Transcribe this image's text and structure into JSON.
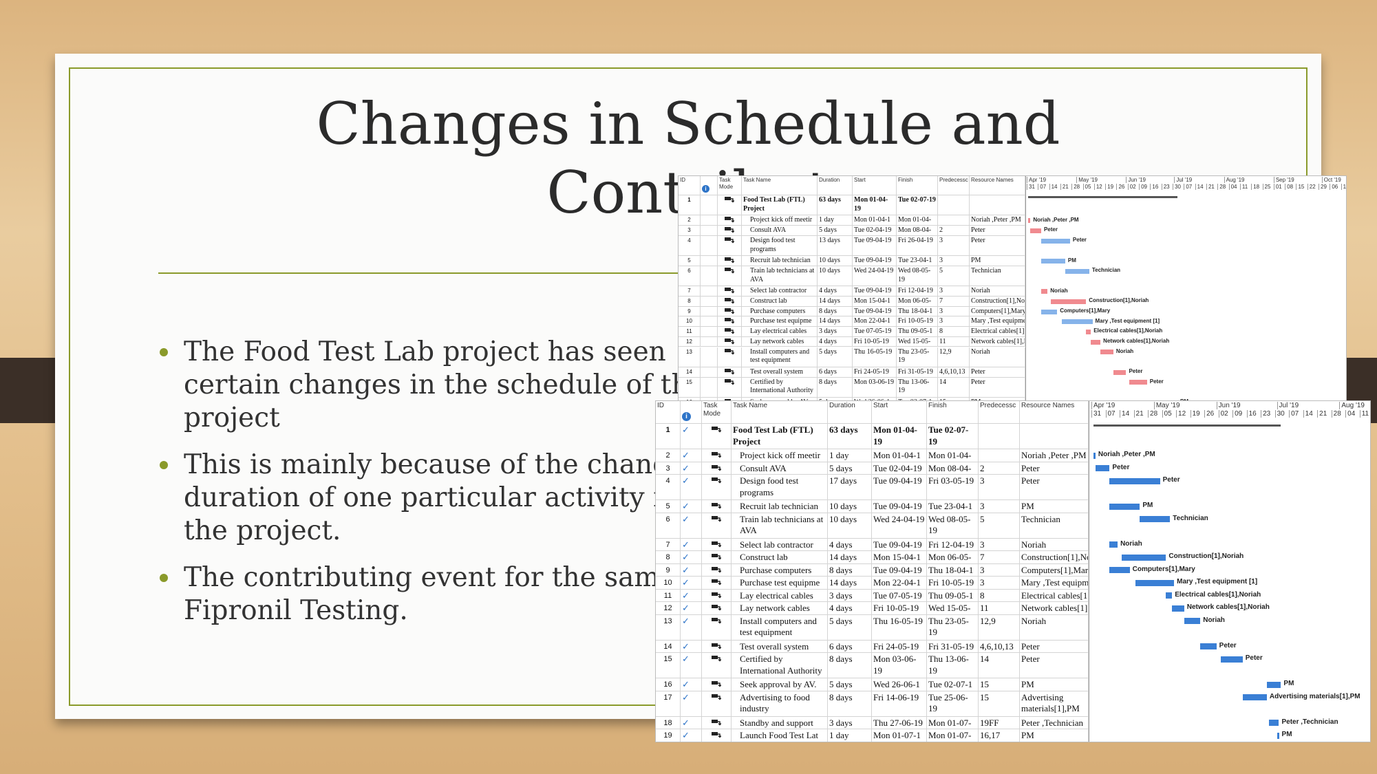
{
  "slide": {
    "title_lines": [
      "Changes in Schedule and",
      "Contribut"
    ],
    "bullets": [
      "The Food Test Lab project has seen certain changes in the schedule of the project",
      "This is mainly because of the change in duration of one particular activity in the project.",
      "The contributing event for the same is Fipronil Testing."
    ]
  },
  "colors": {
    "accent": "#8a9a2a",
    "critical_bar": "#f08a8f",
    "task_bar_top": "#86b3ea",
    "task_bar_bottom": "#3a7fd5",
    "frame_dark": "#3b2f27"
  },
  "columns": {
    "id": "ID",
    "indicator_icon": "info-icon",
    "mode": "Task Mode",
    "name": "Task Name",
    "duration": "Duration",
    "start": "Start",
    "finish": "Finish",
    "pred": "Predecessc",
    "res": "Resource Names"
  },
  "top_gantt": {
    "months": [
      [
        "Apr '19",
        "2019-03-31"
      ],
      [
        "May '19",
        "2019-05-01"
      ],
      [
        "Jun '19",
        "2019-06-01"
      ],
      [
        "Jul '19",
        "2019-07-01"
      ],
      [
        "Aug '19",
        "2019-08-01"
      ],
      [
        "Sep '19",
        "2019-09-01"
      ],
      [
        "Oct '19",
        "2019-10-01"
      ]
    ],
    "weeks": [
      "31",
      "07",
      "14",
      "21",
      "28",
      "05",
      "12",
      "19",
      "26",
      "02",
      "09",
      "16",
      "23",
      "30",
      "07",
      "14",
      "21",
      "28",
      "04",
      "11",
      "18",
      "25",
      "01",
      "08",
      "15",
      "22",
      "29",
      "06",
      "13"
    ],
    "tasks": [
      {
        "id": "1",
        "name": "Food Test Lab (FTL) Project",
        "duration": "63 days",
        "start": "Mon 01-04-19",
        "finish": "Tue 02-07-19",
        "pred": "",
        "res": "",
        "bar": [
          "2019-04-01",
          "2019-07-02"
        ],
        "summary": true
      },
      {
        "id": "2",
        "name": "Project kick off meetir",
        "duration": "1 day",
        "start": "Mon 01-04-1",
        "finish": "Mon 01-04-",
        "pred": "",
        "res": "Noriah ,Peter ,PM",
        "bar": [
          "2019-04-01",
          "2019-04-01"
        ],
        "critical": true
      },
      {
        "id": "3",
        "name": "Consult AVA",
        "duration": "5 days",
        "start": "Tue 02-04-19",
        "finish": "Mon 08-04-",
        "pred": "2",
        "res": "Peter",
        "bar": [
          "2019-04-02",
          "2019-04-08"
        ],
        "critical": true
      },
      {
        "id": "4",
        "name": "Design food test programs",
        "duration": "13 days",
        "start": "Tue 09-04-19",
        "finish": "Fri 26-04-19",
        "pred": "3",
        "res": "Peter",
        "bar": [
          "2019-04-09",
          "2019-04-26"
        ],
        "critical": false
      },
      {
        "id": "5",
        "name": "Recruit lab technician",
        "duration": "10 days",
        "start": "Tue 09-04-19",
        "finish": "Tue 23-04-1",
        "pred": "3",
        "res": "PM",
        "bar": [
          "2019-04-09",
          "2019-04-23"
        ],
        "critical": false
      },
      {
        "id": "6",
        "name": "Train lab technicians at AVA",
        "duration": "10 days",
        "start": "Wed 24-04-19",
        "finish": "Wed 08-05-19",
        "pred": "5",
        "res": "Technician",
        "bar": [
          "2019-04-24",
          "2019-05-08"
        ],
        "critical": false
      },
      {
        "id": "7",
        "name": "Select lab contractor",
        "duration": "4 days",
        "start": "Tue 09-04-19",
        "finish": "Fri 12-04-19",
        "pred": "3",
        "res": "Noriah",
        "bar": [
          "2019-04-09",
          "2019-04-12"
        ],
        "critical": true
      },
      {
        "id": "8",
        "name": "Construct lab",
        "duration": "14 days",
        "start": "Mon 15-04-1",
        "finish": "Mon 06-05-",
        "pred": "7",
        "res": "Construction[1],Noriah",
        "bar": [
          "2019-04-15",
          "2019-05-06"
        ],
        "critical": true
      },
      {
        "id": "9",
        "name": "Purchase computers",
        "duration": "8 days",
        "start": "Tue 09-04-19",
        "finish": "Thu 18-04-1",
        "pred": "3",
        "res": "Computers[1],Mary",
        "bar": [
          "2019-04-09",
          "2019-04-18"
        ],
        "critical": false
      },
      {
        "id": "10",
        "name": "Purchase test equipme",
        "duration": "14 days",
        "start": "Mon 22-04-1",
        "finish": "Fri 10-05-19",
        "pred": "3",
        "res": "Mary ,Test equipment [1]",
        "bar": [
          "2019-04-22",
          "2019-05-10"
        ],
        "critical": false
      },
      {
        "id": "11",
        "name": "Lay electrical cables",
        "duration": "3 days",
        "start": "Tue 07-05-19",
        "finish": "Thu 09-05-1",
        "pred": "8",
        "res": "Electrical cables[1],Noriah",
        "bar": [
          "2019-05-07",
          "2019-05-09"
        ],
        "critical": true
      },
      {
        "id": "12",
        "name": "Lay network cables",
        "duration": "4 days",
        "start": "Fri 10-05-19",
        "finish": "Wed 15-05-",
        "pred": "11",
        "res": "Network cables[1],Noriah",
        "bar": [
          "2019-05-10",
          "2019-05-15"
        ],
        "critical": true
      },
      {
        "id": "13",
        "name": "Install computers and test equipment",
        "duration": "5 days",
        "start": "Thu 16-05-19",
        "finish": "Thu 23-05-19",
        "pred": "12,9",
        "res": "Noriah",
        "bar": [
          "2019-05-16",
          "2019-05-23"
        ],
        "critical": true
      },
      {
        "id": "14",
        "name": "Test overall system",
        "duration": "6 days",
        "start": "Fri 24-05-19",
        "finish": "Fri 31-05-19",
        "pred": "4,6,10,13",
        "res": "Peter",
        "bar": [
          "2019-05-24",
          "2019-05-31"
        ],
        "critical": true
      },
      {
        "id": "15",
        "name": "Certified by International Authority",
        "duration": "8 days",
        "start": "Mon 03-06-19",
        "finish": "Thu 13-06-19",
        "pred": "14",
        "res": "Peter",
        "bar": [
          "2019-06-03",
          "2019-06-13"
        ],
        "critical": true
      },
      {
        "id": "16",
        "name": "Seek approval by AV.",
        "duration": "5 days",
        "start": "Wed 26-06-1",
        "finish": "Tue 02-07-1",
        "pred": "15",
        "res": "PM",
        "bar": [
          "2019-06-26",
          "2019-07-02"
        ],
        "critical": true
      }
    ]
  },
  "bottom_gantt": {
    "months": [
      [
        "Apr '19",
        "2019-03-31"
      ],
      [
        "May '19",
        "2019-05-01"
      ],
      [
        "Jun '19",
        "2019-06-01"
      ],
      [
        "Jul '19",
        "2019-07-01"
      ],
      [
        "Aug '19",
        "2019-08-01"
      ]
    ],
    "weeks": [
      "31",
      "07",
      "14",
      "21",
      "28",
      "05",
      "12",
      "19",
      "26",
      "02",
      "09",
      "16",
      "23",
      "30",
      "07",
      "14",
      "21",
      "28",
      "04",
      "11"
    ],
    "tasks": [
      {
        "id": "1",
        "name": "Food Test Lab (FTL) Project",
        "duration": "63 days",
        "start": "Mon 01-04-19",
        "finish": "Tue 02-07-19",
        "pred": "",
        "res": "",
        "bar": [
          "2019-04-01",
          "2019-07-02"
        ],
        "summary": true
      },
      {
        "id": "2",
        "name": "Project kick off meetir",
        "duration": "1 day",
        "start": "Mon 01-04-1",
        "finish": "Mon 01-04-",
        "pred": "",
        "res": "Noriah ,Peter ,PM",
        "bar": [
          "2019-04-01",
          "2019-04-01"
        ]
      },
      {
        "id": "3",
        "name": "Consult AVA",
        "duration": "5 days",
        "start": "Tue 02-04-19",
        "finish": "Mon 08-04-",
        "pred": "2",
        "res": "Peter",
        "bar": [
          "2019-04-02",
          "2019-04-08"
        ]
      },
      {
        "id": "4",
        "name": "Design food test programs",
        "duration": "17 days",
        "start": "Tue 09-04-19",
        "finish": "Fri 03-05-19",
        "pred": "3",
        "res": "Peter",
        "bar": [
          "2019-04-09",
          "2019-05-03"
        ]
      },
      {
        "id": "5",
        "name": "Recruit lab technician",
        "duration": "10 days",
        "start": "Tue 09-04-19",
        "finish": "Tue 23-04-1",
        "pred": "3",
        "res": "PM",
        "bar": [
          "2019-04-09",
          "2019-04-23"
        ]
      },
      {
        "id": "6",
        "name": "Train lab technicians at AVA",
        "duration": "10 days",
        "start": "Wed 24-04-19",
        "finish": "Wed 08-05-19",
        "pred": "5",
        "res": "Technician",
        "bar": [
          "2019-04-24",
          "2019-05-08"
        ]
      },
      {
        "id": "7",
        "name": "Select lab contractor",
        "duration": "4 days",
        "start": "Tue 09-04-19",
        "finish": "Fri 12-04-19",
        "pred": "3",
        "res": "Noriah",
        "bar": [
          "2019-04-09",
          "2019-04-12"
        ]
      },
      {
        "id": "8",
        "name": "Construct lab",
        "duration": "14 days",
        "start": "Mon 15-04-1",
        "finish": "Mon 06-05-",
        "pred": "7",
        "res": "Construction[1],Noriah",
        "bar": [
          "2019-04-15",
          "2019-05-06"
        ]
      },
      {
        "id": "9",
        "name": "Purchase computers",
        "duration": "8 days",
        "start": "Tue 09-04-19",
        "finish": "Thu 18-04-1",
        "pred": "3",
        "res": "Computers[1],Mary",
        "bar": [
          "2019-04-09",
          "2019-04-18"
        ]
      },
      {
        "id": "10",
        "name": "Purchase test equipme",
        "duration": "14 days",
        "start": "Mon 22-04-1",
        "finish": "Fri 10-05-19",
        "pred": "3",
        "res": "Mary ,Test equipment [1]",
        "bar": [
          "2019-04-22",
          "2019-05-10"
        ]
      },
      {
        "id": "11",
        "name": "Lay electrical cables",
        "duration": "3 days",
        "start": "Tue 07-05-19",
        "finish": "Thu 09-05-1",
        "pred": "8",
        "res": "Electrical cables[1],Noriah",
        "bar": [
          "2019-05-07",
          "2019-05-09"
        ]
      },
      {
        "id": "12",
        "name": "Lay network cables",
        "duration": "4 days",
        "start": "Fri 10-05-19",
        "finish": "Wed 15-05-",
        "pred": "11",
        "res": "Network cables[1],Noriah",
        "bar": [
          "2019-05-10",
          "2019-05-15"
        ]
      },
      {
        "id": "13",
        "name": "Install computers and test equipment",
        "duration": "5 days",
        "start": "Thu 16-05-19",
        "finish": "Thu 23-05-19",
        "pred": "12,9",
        "res": "Noriah",
        "bar": [
          "2019-05-16",
          "2019-05-23"
        ]
      },
      {
        "id": "14",
        "name": "Test overall system",
        "duration": "6 days",
        "start": "Fri 24-05-19",
        "finish": "Fri 31-05-19",
        "pred": "4,6,10,13",
        "res": "Peter",
        "bar": [
          "2019-05-24",
          "2019-05-31"
        ]
      },
      {
        "id": "15",
        "name": "Certified by International Authority",
        "duration": "8 days",
        "start": "Mon 03-06-19",
        "finish": "Thu 13-06-19",
        "pred": "14",
        "res": "Peter",
        "bar": [
          "2019-06-03",
          "2019-06-13"
        ]
      },
      {
        "id": "16",
        "name": "Seek approval by AV.",
        "duration": "5 days",
        "start": "Wed 26-06-1",
        "finish": "Tue 02-07-1",
        "pred": "15",
        "res": "PM",
        "bar": [
          "2019-06-26",
          "2019-07-02"
        ]
      },
      {
        "id": "17",
        "name": "Advertising to food industry",
        "duration": "8 days",
        "start": "Fri 14-06-19",
        "finish": "Tue 25-06-19",
        "pred": "15",
        "res": "Advertising materials[1],PM",
        "bar": [
          "2019-06-14",
          "2019-06-25"
        ]
      },
      {
        "id": "18",
        "name": "Standby and support",
        "duration": "3 days",
        "start": "Thu 27-06-19",
        "finish": "Mon 01-07-",
        "pred": "19FF",
        "res": "Peter ,Technician",
        "bar": [
          "2019-06-27",
          "2019-07-01"
        ]
      },
      {
        "id": "19",
        "name": "Launch Food Test Lat",
        "duration": "1 day",
        "start": "Mon 01-07-1",
        "finish": "Mon 01-07-",
        "pred": "16,17",
        "res": "PM",
        "bar": [
          "2019-07-01",
          "2019-07-01"
        ]
      }
    ]
  }
}
